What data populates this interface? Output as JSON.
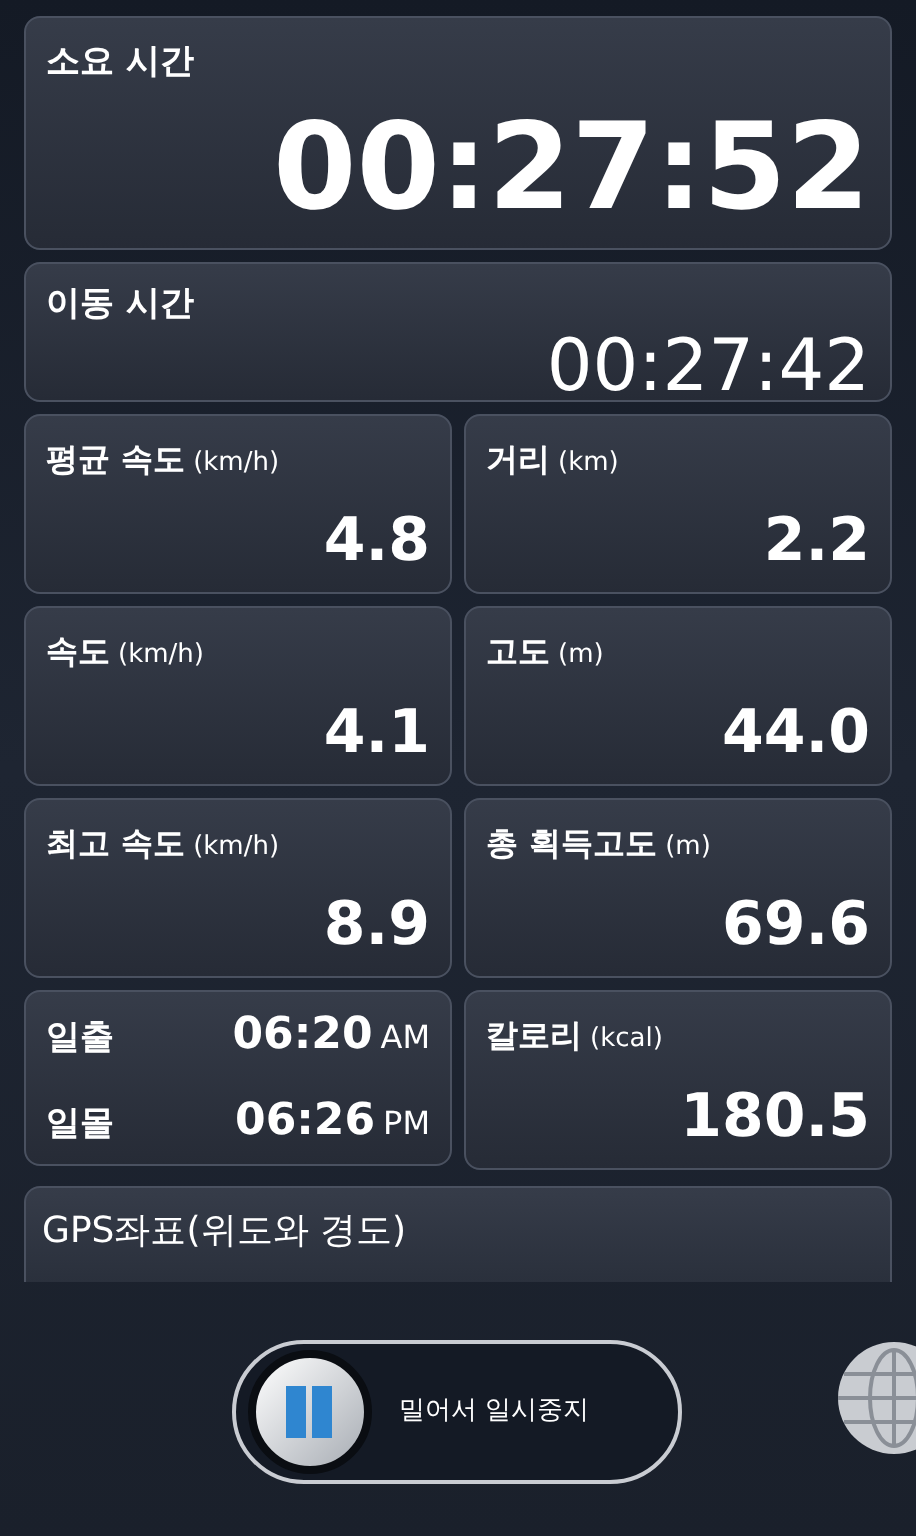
{
  "elapsed": {
    "label": "소요 시간",
    "value": "00:27:52"
  },
  "moving": {
    "label": "이동 시간",
    "value": "00:27:42"
  },
  "stats": [
    {
      "label": "평균 속도",
      "unit": "(km/h)",
      "value": "4.8"
    },
    {
      "label": "거리",
      "unit": "(km)",
      "value": "2.2"
    },
    {
      "label": "속도",
      "unit": "(km/h)",
      "value": "4.1"
    },
    {
      "label": "고도",
      "unit": "(m)",
      "value": "44.0"
    },
    {
      "label": "최고 속도",
      "unit": "(km/h)",
      "value": "8.9"
    },
    {
      "label": "총 획득고도",
      "unit": "(m)",
      "value": "69.6"
    }
  ],
  "sun": [
    {
      "label": "일출",
      "time": "06:20",
      "period": "AM"
    },
    {
      "label": "일몰",
      "time": "06:26",
      "period": "PM"
    }
  ],
  "calories": {
    "label": "칼로리",
    "unit": "(kcal)",
    "value": "180.5"
  },
  "gps": {
    "label": "GPS좌표(위도와 경도)"
  },
  "pause_slider": {
    "label": "밀어서 일시중지"
  }
}
